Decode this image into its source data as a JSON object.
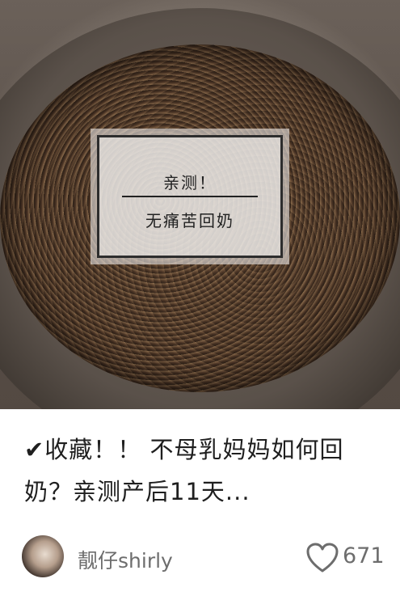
{
  "photo": {
    "overlay_line1": "亲测！",
    "overlay_line2": "无痛苦回奶"
  },
  "post": {
    "title": "✔收藏！！ 不母乳妈妈如何回奶？亲测产后11天..."
  },
  "author": {
    "name": "靓仔shirly"
  },
  "likes": {
    "count": "671",
    "icon": "heart-outline-icon"
  }
}
